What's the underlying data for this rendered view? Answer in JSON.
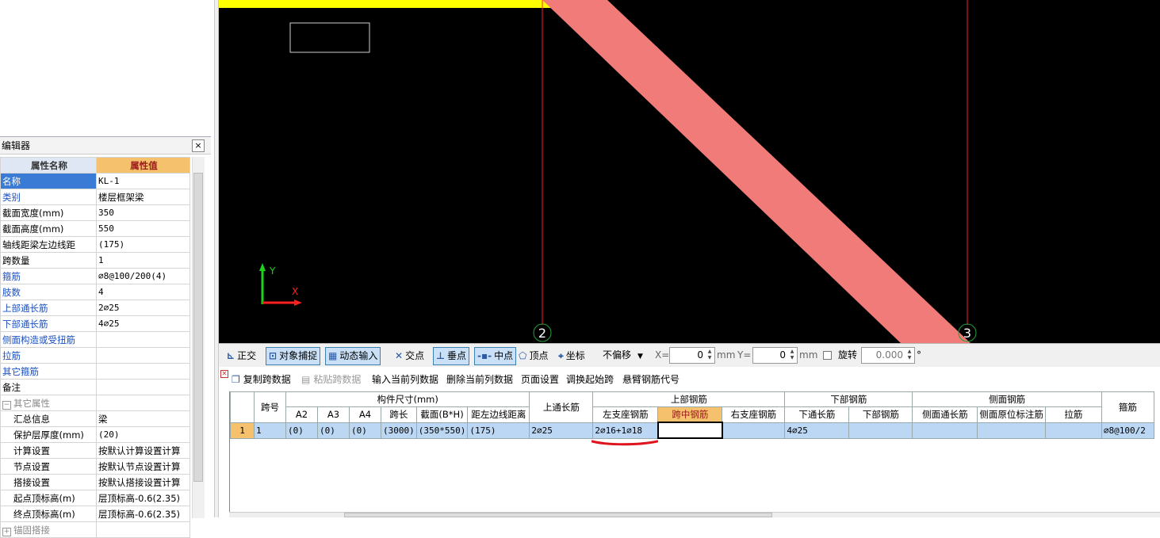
{
  "property_editor": {
    "title": "编辑器",
    "close_label": "×",
    "header_name": "属性名称",
    "header_value": "属性值",
    "rows": [
      {
        "name": "名称",
        "value": "KL-1"
      },
      {
        "name": "类别",
        "value": "楼层框架梁"
      },
      {
        "name": "截面宽度(mm)",
        "value": "350"
      },
      {
        "name": "截面高度(mm)",
        "value": "550"
      },
      {
        "name": "轴线距梁左边线距",
        "value": "(175)"
      },
      {
        "name": "跨数量",
        "value": "1"
      },
      {
        "name": "箍筋",
        "value": "⌀8@100/200(4)"
      },
      {
        "name": "肢数",
        "value": "4"
      },
      {
        "name": "上部通长筋",
        "value": "2⌀25"
      },
      {
        "name": "下部通长筋",
        "value": "4⌀25"
      },
      {
        "name": "侧面构造或受扭筋",
        "value": ""
      },
      {
        "name": "拉筋",
        "value": ""
      },
      {
        "name": "其它箍筋",
        "value": ""
      },
      {
        "name": "备注",
        "value": ""
      },
      {
        "name": "其它属性",
        "value": "",
        "expander": "−"
      },
      {
        "name": "汇总信息",
        "value": "梁"
      },
      {
        "name": "保护层厚度(mm)",
        "value": "(20)"
      },
      {
        "name": "计算设置",
        "value": "按默认计算设置计算"
      },
      {
        "name": "节点设置",
        "value": "按默认节点设置计算"
      },
      {
        "name": "搭接设置",
        "value": "按默认搭接设置计算"
      },
      {
        "name": "起点顶标高(m)",
        "value": "层顶标高-0.6(2.35)"
      },
      {
        "name": "终点顶标高(m)",
        "value": "层顶标高-0.6(2.35)"
      },
      {
        "name": "锚固搭接",
        "value": "",
        "expander": "+"
      }
    ]
  },
  "canvas": {
    "axis_y": "Y",
    "axis_x": "X",
    "grid_labels": [
      "2",
      "3"
    ],
    "colors": {
      "background": "#000000",
      "beam": "#f07b78",
      "axis_line": "#ff2020",
      "highlight": "#ffff00"
    }
  },
  "snap_toolbar": {
    "ortho": "正交",
    "object_snap": "对象捕捉",
    "dynamic_input": "动态输入",
    "intersection": "交点",
    "perpendicular": "垂点",
    "midpoint": "中点",
    "vertex": "顶点",
    "coordinate": "坐标",
    "offset_mode": "不偏移",
    "x_label": "X=",
    "x_value": "0",
    "y_label": "Y=",
    "y_value": "0",
    "unit": "mm",
    "rotate_label": "旋转",
    "rotate_value": "0.000",
    "degree": "°"
  },
  "grid_toolbar": {
    "copy_span": "复制跨数据",
    "paste_span": "粘贴跨数据",
    "input_column": "输入当前列数据",
    "delete_column": "删除当前列数据",
    "page_setup": "页面设置",
    "adjust_start": "调换起始跨",
    "cantilever_code": "悬臂钢筋代号"
  },
  "rebar_grid": {
    "headers": {
      "span_no": "跨号",
      "dimensions": "构件尺寸(mm)",
      "a2": "A2",
      "a3": "A3",
      "a4": "A4",
      "span_length": "跨长",
      "section": "截面(B*H)",
      "edge_distance": "距左边线距离",
      "top_through": "上通长筋",
      "top_rebar": "上部钢筋",
      "left_support": "左支座钢筋",
      "mid_span": "跨中钢筋",
      "right_support": "右支座钢筋",
      "bottom_rebar": "下部钢筋",
      "bottom_through": "下通长筋",
      "bottom_bars": "下部钢筋",
      "side_rebar": "侧面钢筋",
      "side_through": "侧面通长筋",
      "side_inplace": "侧面原位标注筋",
      "tie_bar": "拉筋",
      "stirrup": "箍筋"
    },
    "rows": [
      {
        "row_no": "1",
        "span_no": "1",
        "a2": "(0)",
        "a3": "(0)",
        "a4": "(0)",
        "span_length": "(3000)",
        "section": "(350*550)",
        "edge_distance": "(175)",
        "top_through": "2⌀25",
        "left_support": "2⌀16+1⌀18",
        "mid_span": "",
        "right_support": "",
        "bottom_through": "4⌀25",
        "bottom_bars": "",
        "side_through": "",
        "side_inplace": "",
        "tie_bar": "",
        "stirrup": "⌀8@100/2"
      }
    ]
  }
}
